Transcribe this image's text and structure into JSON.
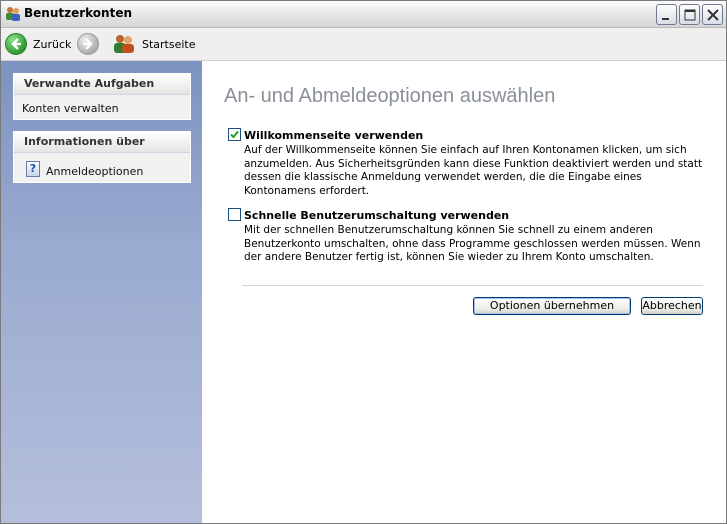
{
  "window": {
    "title": "Benutzerkonten"
  },
  "toolbar": {
    "back_label": "Zurück",
    "home_label": "Startseite"
  },
  "sidebar": {
    "related_tasks": {
      "header": "Verwandte Aufgaben",
      "items": [
        {
          "label": "Konten verwalten"
        }
      ]
    },
    "info": {
      "header": "Informationen über",
      "items": [
        {
          "label": "Anmeldeoptionen",
          "icon": "help-icon"
        }
      ]
    }
  },
  "main": {
    "heading": "An- und Abmeldeoptionen auswählen",
    "options": [
      {
        "label": "Willkommenseite verwenden",
        "checked": true,
        "description": "Auf der Willkommenseite können Sie einfach auf Ihren Kontonamen klicken, um sich anzumelden. Aus Sicherheitsgründen kann diese Funktion deaktiviert werden und statt dessen die klassische Anmeldung verwendet werden, die die Eingabe eines Kontonamens erfordert."
      },
      {
        "label": "Schnelle Benutzerumschaltung verwenden",
        "checked": false,
        "description": "Mit der schnellen Benutzerumschaltung können Sie schnell zu einem anderen Benutzerkonto umschalten, ohne dass Programme geschlossen werden müssen. Wenn der andere Benutzer fertig ist, können Sie wieder zu Ihrem Konto umschalten."
      }
    ],
    "buttons": {
      "apply_label": "Optionen übernehmen",
      "cancel_label": "Abbrechen"
    }
  },
  "colors": {
    "sidebar_gradient_top": "#7c93c0",
    "sidebar_gradient_bottom": "#b4bfdb",
    "heading": "#8a9099",
    "back_button": "#2f9b2f"
  }
}
